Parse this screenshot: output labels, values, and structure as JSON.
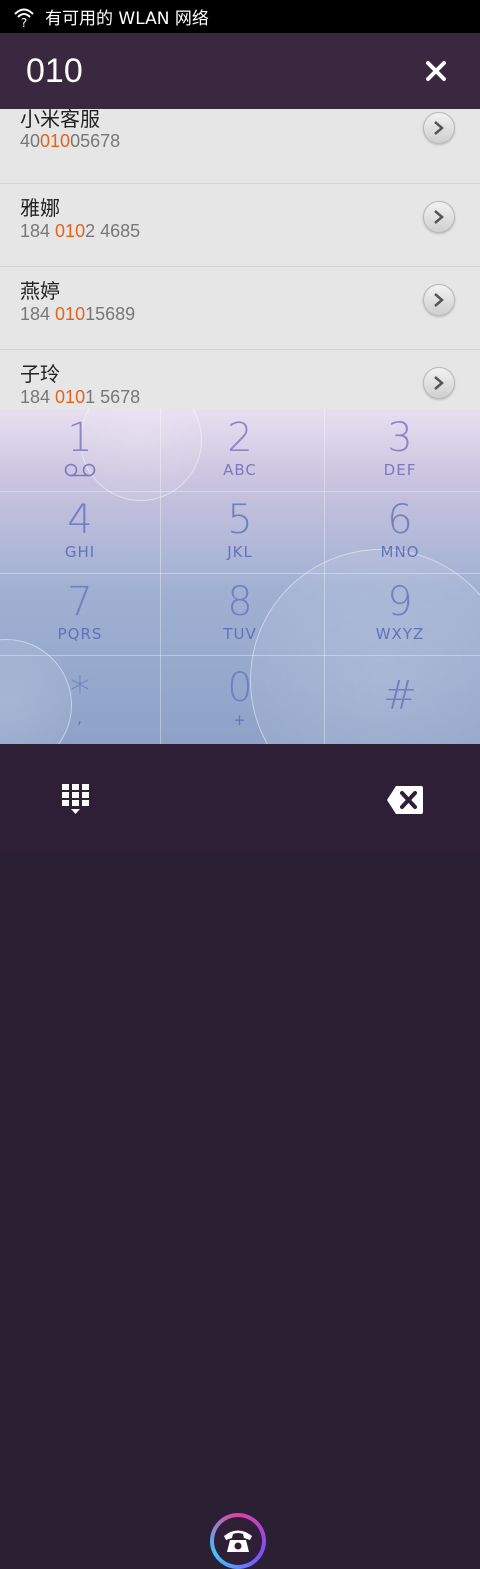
{
  "status_bar": {
    "wifi_text": "有可用的 WLAN 网络",
    "icon": "wifi-question-icon"
  },
  "header": {
    "dialed_number": "010",
    "clear_icon": "close-icon"
  },
  "results": [
    {
      "name": "小米客服",
      "num_pre": "40",
      "num_hl": "010",
      "num_post": "05678"
    },
    {
      "name": "雅娜",
      "num_pre": "184 ",
      "num_hl": "010",
      "num_post": "2 4685"
    },
    {
      "name": "燕婷",
      "num_pre": "184 ",
      "num_hl": "010",
      "num_post": "15689"
    },
    {
      "name": "子玲",
      "num_pre": "184 ",
      "num_hl": "010",
      "num_post": "1 5678"
    }
  ],
  "keys": [
    {
      "digit": "1",
      "letters": ""
    },
    {
      "digit": "2",
      "letters": "ABC"
    },
    {
      "digit": "3",
      "letters": "DEF"
    },
    {
      "digit": "4",
      "letters": "GHI"
    },
    {
      "digit": "5",
      "letters": "JKL"
    },
    {
      "digit": "6",
      "letters": "MNO"
    },
    {
      "digit": "7",
      "letters": "PQRS"
    },
    {
      "digit": "8",
      "letters": "TUV"
    },
    {
      "digit": "9",
      "letters": "WXYZ"
    },
    {
      "digit": "*",
      "letters": ","
    },
    {
      "digit": "0",
      "letters": "+"
    },
    {
      "digit": "#",
      "letters": ""
    }
  ],
  "bottom_bar": {
    "dialpad_icon": "dialpad-icon",
    "call_icon": "phone-icon",
    "delete_icon": "backspace-icon"
  },
  "colors": {
    "highlight": "#e8611a",
    "header_bg": "#3a2840",
    "bottom_bg": "#2e1f36"
  }
}
